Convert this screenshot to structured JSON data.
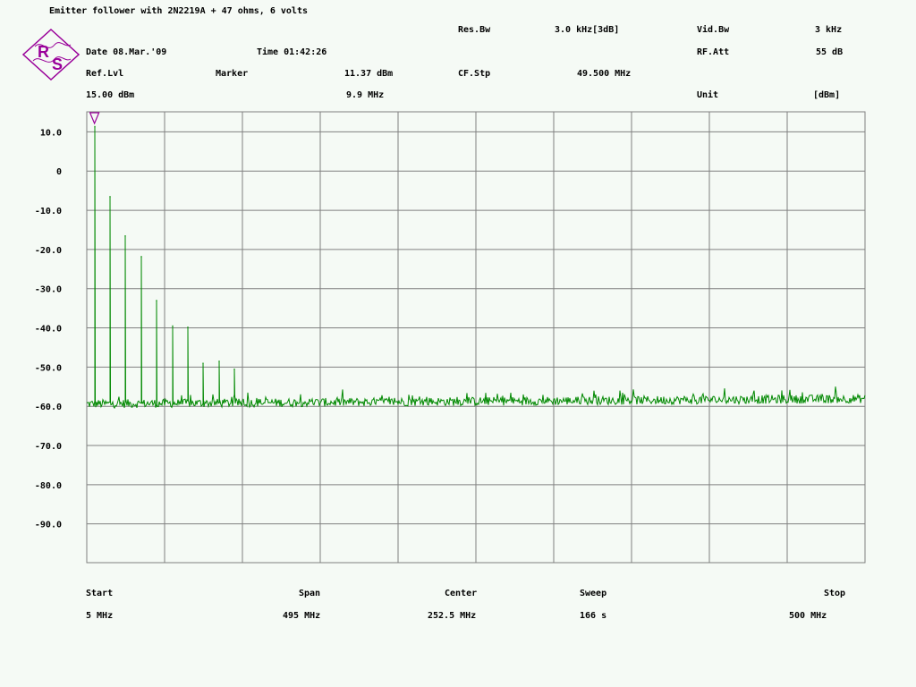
{
  "header": {
    "title": "Emitter follower with 2N2219A + 47 ohms, 6 volts",
    "res_bw_label": "Res.Bw",
    "res_bw_value": "3.0 kHz[3dB]",
    "vid_bw_label": "Vid.Bw",
    "vid_bw_value": "3 kHz",
    "date": "Date 08.Mar.'09",
    "time": "Time 01:42:26",
    "rf_att_label": "RF.Att",
    "rf_att_value": "55 dB",
    "ref_lvl_label": "Ref.Lvl",
    "ref_lvl_value": "15.00 dBm",
    "marker_label": "Marker",
    "marker_level": "11.37 dBm",
    "marker_freq": "9.9 MHz",
    "cf_stp_label": "CF.Stp",
    "cf_stp_value": "49.500 MHz",
    "unit_label": "Unit",
    "unit_value": "[dBm]"
  },
  "logo": {
    "icon": "rohde-schwarz-logo",
    "text_top": "R",
    "text_bottom": "S",
    "color": "#990099"
  },
  "footer": {
    "start_label": "Start",
    "start_value": "5 MHz",
    "span_label": "Span",
    "span_value": "495 MHz",
    "center_label": "Center",
    "center_value": "252.5 MHz",
    "sweep_label": "Sweep",
    "sweep_value": "166 s",
    "stop_label": "Stop",
    "stop_value": "500 MHz"
  },
  "chart_data": {
    "type": "line",
    "xlim": [
      5,
      500
    ],
    "ylim": [
      -100,
      15
    ],
    "grid": true,
    "ytick_labels": [
      "10.0",
      "0",
      "-10.0",
      "-20.0",
      "-30.0",
      "-40.0",
      "-50.0",
      "-60.0",
      "-70.0",
      "-80.0",
      "-90.0"
    ],
    "ytick_values": [
      10,
      0,
      -10,
      -20,
      -30,
      -40,
      -50,
      -60,
      -70,
      -80,
      -90
    ],
    "noise_floor": -59.5,
    "noise_floor_end": -58.2,
    "series": [
      {
        "color": "#008800",
        "peaks": [
          {
            "x": 9.9,
            "y": 11.37
          },
          {
            "x": 19.8,
            "y": -6.5
          },
          {
            "x": 29.7,
            "y": -16.5
          },
          {
            "x": 39.6,
            "y": -21.8
          },
          {
            "x": 49.5,
            "y": -33
          },
          {
            "x": 59.4,
            "y": -39.5
          },
          {
            "x": 69.3,
            "y": -39.8
          },
          {
            "x": 79.2,
            "y": -49
          },
          {
            "x": 89.1,
            "y": -48.5
          },
          {
            "x": 99,
            "y": -50.5
          }
        ]
      }
    ],
    "marker": {
      "x": 9.9,
      "y": 11.37,
      "color": "#990099"
    },
    "grid_color": "#808080",
    "label_color": "#000000"
  }
}
